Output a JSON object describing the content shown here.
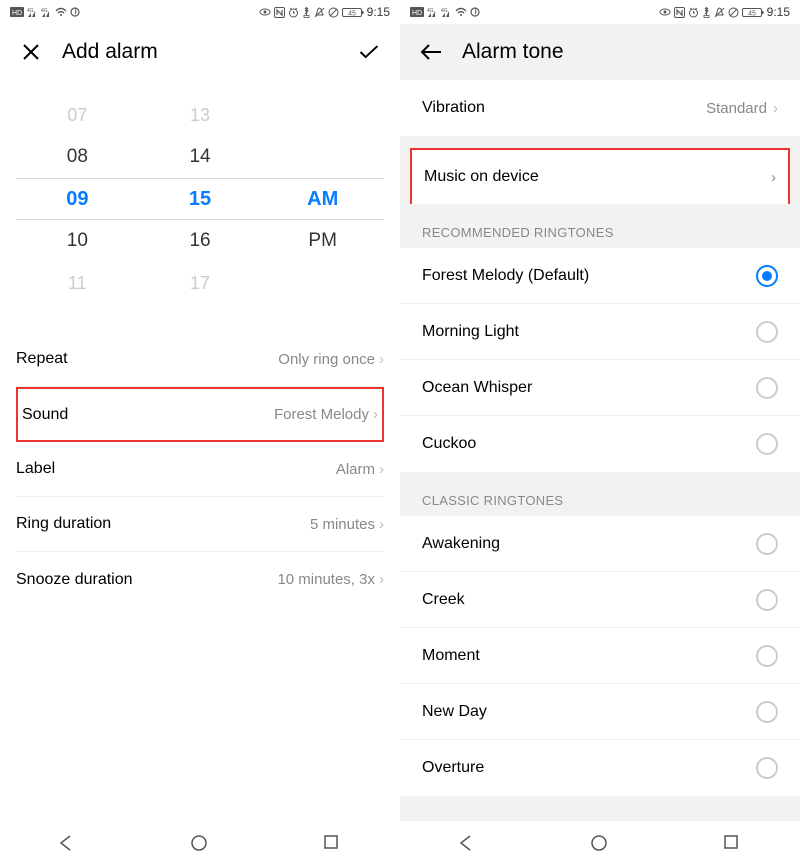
{
  "status": {
    "left_indicators": [
      "HD-B",
      "4G-signal",
      "4G-signal",
      "wifi",
      "swirl"
    ],
    "right_indicators": [
      "eye",
      "nfc",
      "alarm",
      "bt-battery",
      "dnd",
      "no-data",
      "battery-45"
    ],
    "battery_text": "45",
    "time": "9:15"
  },
  "left": {
    "title": "Add alarm",
    "picker": {
      "hours": [
        "07",
        "08",
        "09",
        "10",
        "11"
      ],
      "minutes": [
        "13",
        "14",
        "15",
        "16",
        "17"
      ],
      "ampm": [
        "",
        "",
        "AM",
        "PM",
        ""
      ],
      "selected_index": 2
    },
    "rows": [
      {
        "label": "Repeat",
        "value": "Only ring once",
        "highlighted": false
      },
      {
        "label": "Sound",
        "value": "Forest Melody",
        "highlighted": true
      },
      {
        "label": "Label",
        "value": "Alarm",
        "highlighted": false
      },
      {
        "label": "Ring duration",
        "value": "5 minutes",
        "highlighted": false
      },
      {
        "label": "Snooze duration",
        "value": "10 minutes, 3x",
        "highlighted": false
      }
    ]
  },
  "right": {
    "title": "Alarm tone",
    "vibration": {
      "label": "Vibration",
      "value": "Standard"
    },
    "music": {
      "label": "Music on device",
      "highlighted": true
    },
    "sections": [
      {
        "header": "RECOMMENDED RINGTONES",
        "items": [
          {
            "label": "Forest Melody (Default)",
            "selected": true
          },
          {
            "label": "Morning Light",
            "selected": false
          },
          {
            "label": "Ocean Whisper",
            "selected": false
          },
          {
            "label": "Cuckoo",
            "selected": false
          }
        ]
      },
      {
        "header": "CLASSIC RINGTONES",
        "items": [
          {
            "label": "Awakening",
            "selected": false
          },
          {
            "label": "Creek",
            "selected": false
          },
          {
            "label": "Moment",
            "selected": false
          },
          {
            "label": "New Day",
            "selected": false
          },
          {
            "label": "Overture",
            "selected": false
          }
        ]
      }
    ]
  }
}
